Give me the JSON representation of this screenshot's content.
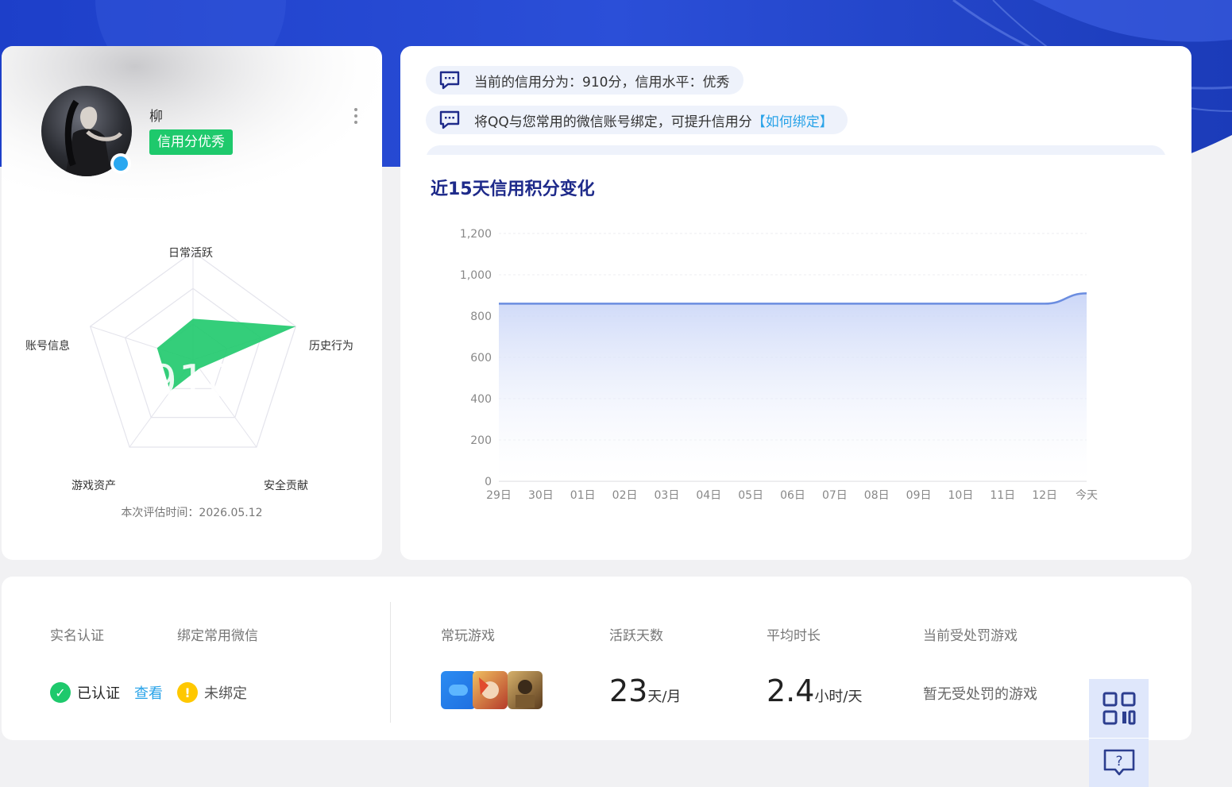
{
  "profile": {
    "name": "柳",
    "credit_tag": "信用分优秀",
    "radar": {
      "score": "910",
      "axes": [
        "日常活跃",
        "历史行为",
        "安全贡献",
        "游戏资产",
        "账号信息"
      ],
      "values": [
        0.38,
        1.0,
        0.1,
        0.36,
        0.35
      ]
    },
    "eval_time_label": "本次评估时间：",
    "eval_time": "2026.05.12"
  },
  "notices": {
    "score_text": "当前的信用分为：910分，信用水平：优秀",
    "bind_text": "将QQ与您常用的微信账号绑定，可提升信用分",
    "bind_link": "【如何绑定】"
  },
  "chart_title": "近15天信用积分变化",
  "chart_data": {
    "type": "area",
    "title": "近15天信用积分变化",
    "x": [
      "29日",
      "30日",
      "01日",
      "02日",
      "03日",
      "04日",
      "05日",
      "06日",
      "07日",
      "08日",
      "09日",
      "10日",
      "11日",
      "12日",
      "今天"
    ],
    "series": [
      {
        "values": [
          860,
          860,
          860,
          860,
          860,
          860,
          860,
          860,
          860,
          860,
          860,
          860,
          860,
          860,
          910
        ]
      }
    ],
    "yticks": [
      "0",
      "200",
      "400",
      "600",
      "800",
      "1,000",
      "1,200"
    ],
    "ylim": [
      0,
      1200
    ],
    "color": "#6b8de0"
  },
  "stats": {
    "realname_label": "实名认证",
    "wechat_label": "绑定常用微信",
    "realname_status": "已认证",
    "view_link": "查看",
    "wechat_status": "未绑定",
    "games_label": "常玩游戏",
    "active_label": "活跃天数",
    "active_value": "23",
    "active_unit": "天/月",
    "avg_label": "平均时长",
    "avg_value": "2.4",
    "avg_unit": "小时/天",
    "punish_label": "当前受处罚游戏",
    "punish_text": "暂无受处罚的游戏"
  },
  "colors": {
    "accent": "#1e2a8a",
    "green": "#1ec96c",
    "link": "#29a3e8",
    "warn": "#ffc800",
    "hero": "#2347d1"
  },
  "icons": [
    "qq-icon",
    "message-icon",
    "more-icon",
    "check-icon",
    "warning-icon",
    "qrcode-icon",
    "help-icon"
  ]
}
